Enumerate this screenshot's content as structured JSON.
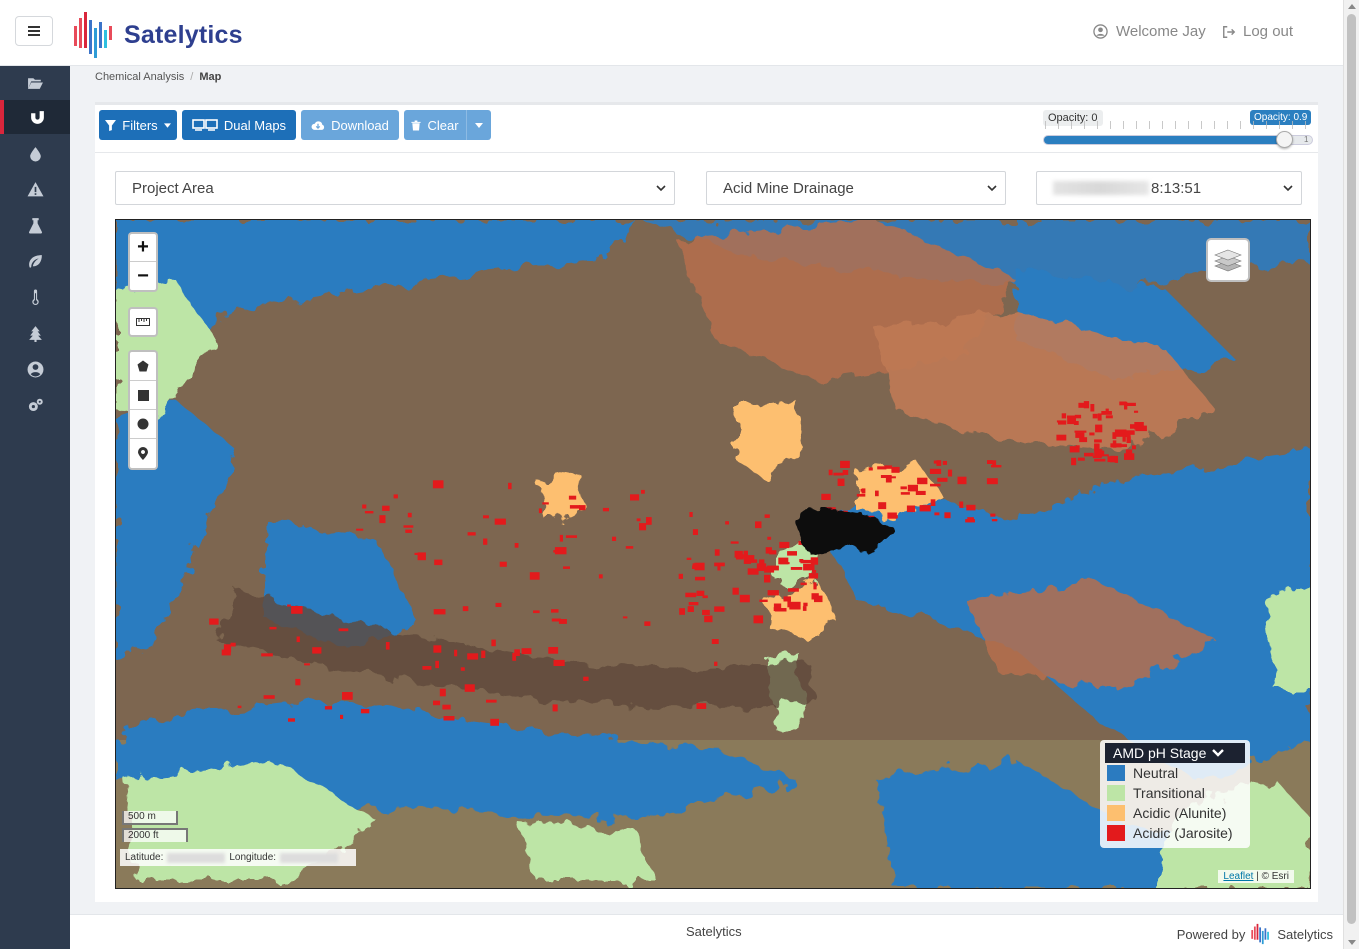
{
  "header": {
    "brand": "Satelytics",
    "welcome": "Welcome Jay",
    "logout": "Log out",
    "menu_icon": "hamburger-icon"
  },
  "sidebar": {
    "items": [
      {
        "icon": "folder-open-icon",
        "active": false
      },
      {
        "icon": "magnet-icon",
        "active": true
      },
      {
        "icon": "droplet-icon",
        "active": false
      },
      {
        "icon": "warning-icon",
        "active": false
      },
      {
        "icon": "flask-icon",
        "active": false
      },
      {
        "icon": "leaf-icon",
        "active": false
      },
      {
        "icon": "thermometer-icon",
        "active": false
      },
      {
        "icon": "tree-icon",
        "active": false
      },
      {
        "icon": "user-circle-icon",
        "active": false
      },
      {
        "icon": "gears-icon",
        "active": false
      }
    ]
  },
  "breadcrumb": {
    "parent": "Chemical Analysis",
    "separator": "/",
    "current": "Map"
  },
  "toolbar": {
    "filters_label": "Filters",
    "dual_maps_label": "Dual Maps",
    "download_label": "Download",
    "clear_label": "Clear",
    "opacity_min_label": "Opacity: 0",
    "opacity_max_label": "Opacity: 0.9",
    "opacity_end_tick": "1",
    "opacity_value": 0.9
  },
  "selectors": {
    "project_area": "Project Area",
    "layer": "Acid Mine Drainage",
    "date_time": "8:13:51"
  },
  "map": {
    "zoom_in": "+",
    "zoom_out": "−",
    "scale_metric": "500 m",
    "scale_imperial": "2000 ft",
    "latitude_label": "Latitude:",
    "longitude_label": "Longitude:",
    "attribution_leaflet": "Leaflet",
    "attribution_sep": " | © ",
    "attribution_esri": "Esri",
    "legend": {
      "title": "AMD pH Stage",
      "items": [
        {
          "label": "Neutral",
          "color": "#2b7bc0"
        },
        {
          "label": "Transitional",
          "color": "#bde5a6"
        },
        {
          "label": "Acidic (Alunite)",
          "color": "#fdbf6f"
        },
        {
          "label": "Acidic (Jarosite)",
          "color": "#e31a1c"
        }
      ]
    }
  },
  "footer": {
    "center": "Satelytics",
    "powered_by": "Powered by",
    "brand": "Satelytics"
  },
  "colors": {
    "primary": "#1d6fb8",
    "primary_light": "#6aa6db",
    "sidebar_bg": "#2e3b4e",
    "active_accent": "#d9263c",
    "brand_text": "#2e3f8f"
  }
}
